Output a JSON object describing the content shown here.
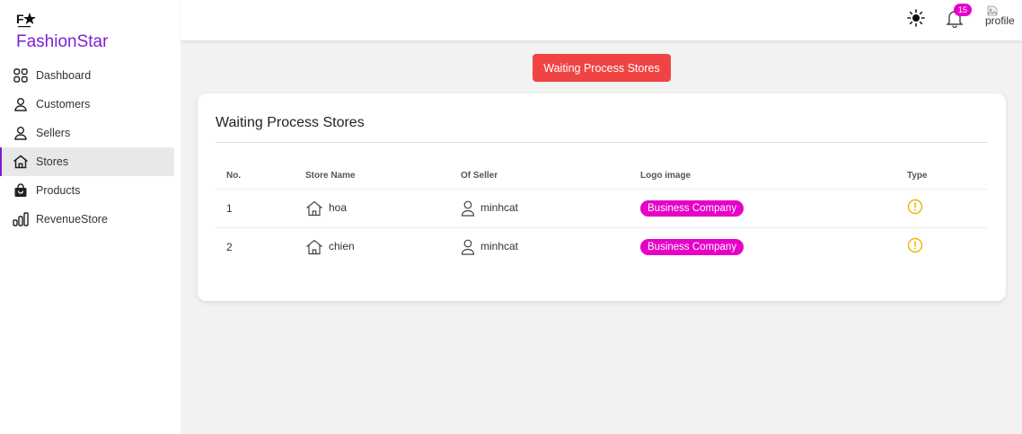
{
  "app": {
    "brand": "FashionStar",
    "accent_color": "#7b1fd6"
  },
  "sidebar": {
    "items": [
      {
        "label": "Dashboard",
        "icon": "grid-icon"
      },
      {
        "label": "Customers",
        "icon": "user-icon"
      },
      {
        "label": "Sellers",
        "icon": "user-icon"
      },
      {
        "label": "Stores",
        "icon": "home-icon",
        "active": true
      },
      {
        "label": "Products",
        "icon": "shopping-bag-icon"
      },
      {
        "label": "RevenueStore",
        "icon": "bar-chart-icon"
      }
    ]
  },
  "topbar": {
    "notification_count": "15",
    "profile_alt": "profile"
  },
  "header": {
    "button_label": "Waiting Process Stores",
    "button_color": "#f04444"
  },
  "card": {
    "title": "Waiting Process Stores",
    "columns": [
      "No.",
      "Store Name",
      "Of Seller",
      "Logo image",
      "Type"
    ],
    "rows": [
      {
        "no": "1",
        "store_name": "hoa",
        "seller": "minhcat",
        "logo": "Business Company",
        "type_icon": "pending-icon"
      },
      {
        "no": "2",
        "store_name": "chien",
        "seller": "minhcat",
        "logo": "Business Company",
        "type_icon": "pending-icon"
      }
    ],
    "pill_color": "#e600c8",
    "pending_color": "#f0b400"
  }
}
